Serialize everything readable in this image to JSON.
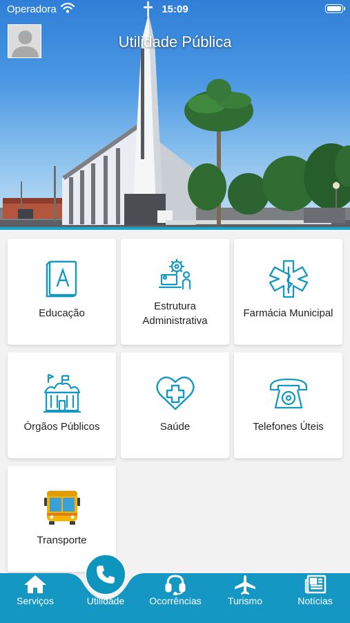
{
  "status_bar": {
    "carrier": "Operadora",
    "time": "15:09"
  },
  "header": {
    "title": "Utilidade Pública"
  },
  "accent_color": "#1497c3",
  "grid": {
    "items": [
      {
        "label": "Educação",
        "icon": "book-icon"
      },
      {
        "label": "Estrutura Administrativa",
        "icon": "admin-structure-icon"
      },
      {
        "label": "Farmácia Municipal",
        "icon": "pharmacy-icon"
      },
      {
        "label": "Órgãos Públicos",
        "icon": "public-building-icon"
      },
      {
        "label": "Saúde",
        "icon": "heart-health-icon"
      },
      {
        "label": "Telefones Úteis",
        "icon": "telephone-icon"
      },
      {
        "label": "Transporte",
        "icon": "bus-icon"
      }
    ]
  },
  "tabbar": {
    "items": [
      {
        "label": "Serviços",
        "icon": "home-icon"
      },
      {
        "label": "Utilidade",
        "icon": "phone-icon",
        "active": true
      },
      {
        "label": "Ocorrências",
        "icon": "headset-icon"
      },
      {
        "label": "Turismo",
        "icon": "airplane-icon"
      },
      {
        "label": "Notícias",
        "icon": "newspaper-icon"
      }
    ]
  }
}
